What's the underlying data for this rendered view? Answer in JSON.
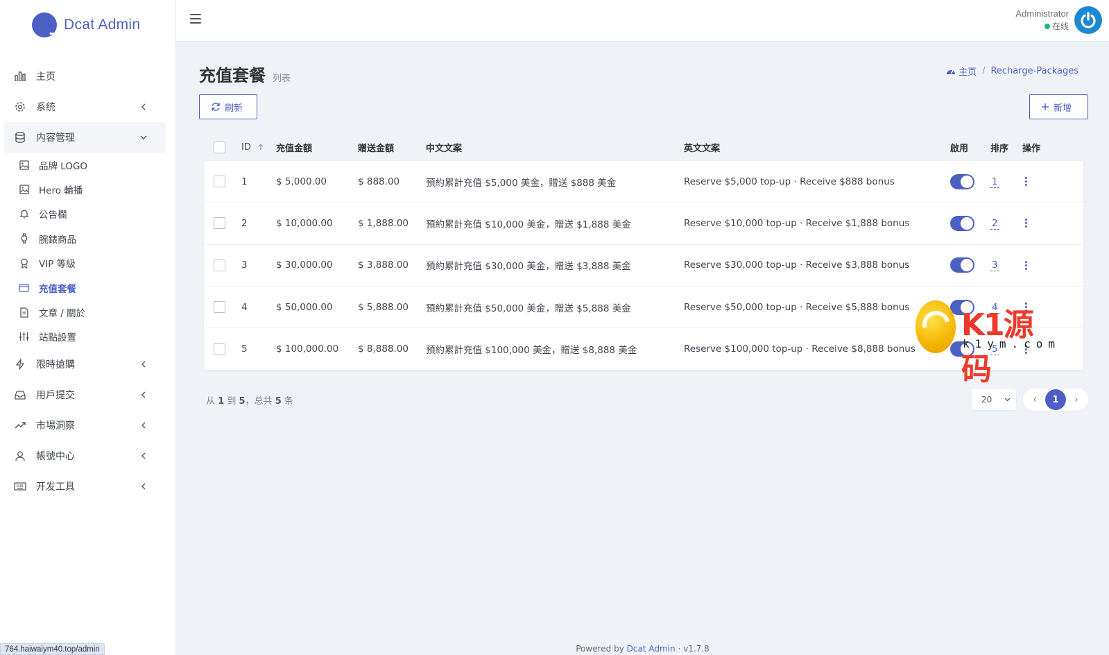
{
  "brand": {
    "name": "Dcat Admin"
  },
  "sidebar": {
    "items": [
      {
        "label": "主页",
        "icon": "bar-chart-icon",
        "has_children": false
      },
      {
        "label": "系统",
        "icon": "gear-icon",
        "has_children": true
      },
      {
        "label": "内容管理",
        "icon": "database-icon",
        "has_children": true,
        "open": true,
        "children": [
          {
            "label": "品牌 LOGO",
            "icon": "image-icon"
          },
          {
            "label": "Hero 輪播",
            "icon": "image-icon"
          },
          {
            "label": "公告欄",
            "icon": "bell-icon"
          },
          {
            "label": "腕錶商品",
            "icon": "watch-icon"
          },
          {
            "label": "VIP 等級",
            "icon": "award-icon"
          },
          {
            "label": "充值套餐",
            "icon": "credit-card-icon",
            "active": true
          },
          {
            "label": "文章 / 關於",
            "icon": "file-text-icon"
          },
          {
            "label": "站點設置",
            "icon": "sliders-icon"
          }
        ]
      },
      {
        "label": "限時搶購",
        "icon": "zap-icon",
        "has_children": true
      },
      {
        "label": "用戶提交",
        "icon": "inbox-icon",
        "has_children": true
      },
      {
        "label": "市場洞察",
        "icon": "trending-up-icon",
        "has_children": true
      },
      {
        "label": "帳號中心",
        "icon": "user-icon",
        "has_children": true
      },
      {
        "label": "开发工具",
        "icon": "keyboard-icon",
        "has_children": true
      }
    ]
  },
  "header": {
    "user_name": "Administrator",
    "user_status": "在线",
    "status_color": "#21b978"
  },
  "page": {
    "title": "充值套餐",
    "subtitle": "列表",
    "breadcrumb": {
      "home": "主页",
      "current": "Recharge-Packages"
    }
  },
  "toolbar": {
    "refresh_label": "刷新",
    "new_label": "新增"
  },
  "table": {
    "headers": {
      "id": "ID",
      "amount": "充值金額",
      "bonus": "贈送金額",
      "zh": "中文文案",
      "en": "英文文案",
      "enabled": "啟用",
      "sort": "排序",
      "ops": "操作"
    },
    "rows": [
      {
        "id": "1",
        "amount": "$ 5,000.00",
        "bonus": "$ 888.00",
        "zh": "預約累計充值 $5,000 美金，贈送 $888 美金",
        "en": "Reserve $5,000 top-up · Receive $888 bonus",
        "enabled": true,
        "sort": "1"
      },
      {
        "id": "2",
        "amount": "$ 10,000.00",
        "bonus": "$ 1,888.00",
        "zh": "預約累計充值 $10,000 美金，贈送 $1,888 美金",
        "en": "Reserve $10,000 top-up · Receive $1,888 bonus",
        "enabled": true,
        "sort": "2"
      },
      {
        "id": "3",
        "amount": "$ 30,000.00",
        "bonus": "$ 3,888.00",
        "zh": "預約累計充值 $30,000 美金，贈送 $3,888 美金",
        "en": "Reserve $30,000 top-up · Receive $3,888 bonus",
        "enabled": true,
        "sort": "3"
      },
      {
        "id": "4",
        "amount": "$ 50,000.00",
        "bonus": "$ 5,888.00",
        "zh": "預約累計充值 $50,000 美金，贈送 $5,888 美金",
        "en": "Reserve $50,000 top-up · Receive $5,888 bonus",
        "enabled": true,
        "sort": "4"
      },
      {
        "id": "5",
        "amount": "$ 100,000.00",
        "bonus": "$ 8,888.00",
        "zh": "預約累計充值 $100,000 美金，贈送 $8,888 美金",
        "en": "Reserve $100,000 top-up · Receive $8,888 bonus",
        "enabled": true,
        "sort": "5"
      }
    ]
  },
  "pagination": {
    "info_prefix": "从",
    "from": "1",
    "to_word": "到",
    "to": "5",
    "total_word": "，总共",
    "total": "5",
    "unit": "条",
    "per_page": "20",
    "current_page": "1"
  },
  "footer": {
    "powered_by": "Powered by",
    "link": "Dcat Admin",
    "sep": "·",
    "version": "v1.7.8"
  },
  "status_bar": {
    "url": "764.haiwaiym40.top/admin"
  },
  "watermark": {
    "text": "K1源码",
    "sub": "k1ym.com"
  },
  "colors": {
    "accent": "#4c60c4",
    "online": "#21b978",
    "avatar": "#1c88d4"
  }
}
